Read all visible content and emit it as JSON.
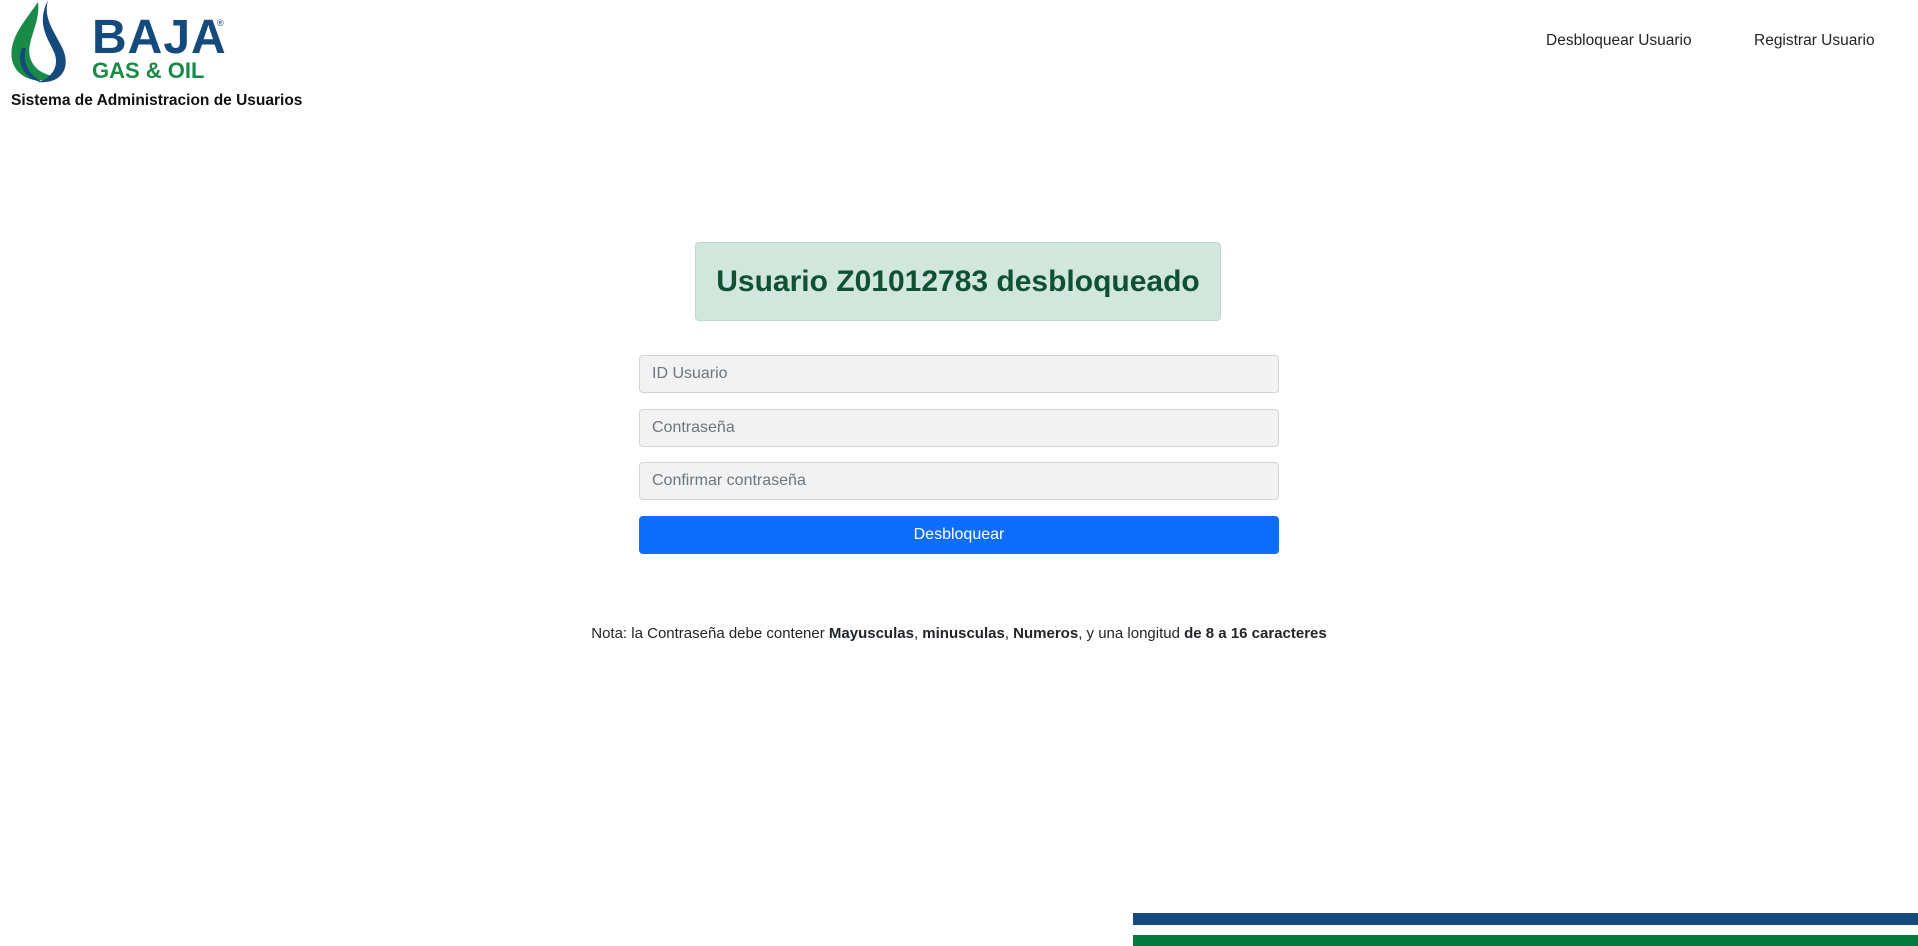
{
  "header": {
    "logo": {
      "brand": "BAJA",
      "registered": "®",
      "tagline": "GAS & OIL"
    },
    "subtitle": "Sistema de Administracion de Usuarios",
    "nav": [
      {
        "label": "Desbloquear Usuario"
      },
      {
        "label": "Registrar Usuario"
      }
    ]
  },
  "alert": {
    "message": "Usuario Z01012783 desbloqueado",
    "type": "success"
  },
  "form": {
    "user_id": {
      "placeholder": "ID Usuario",
      "value": ""
    },
    "password": {
      "placeholder": "Contraseña",
      "value": ""
    },
    "confirm_password": {
      "placeholder": "Confirmar contraseña",
      "value": ""
    },
    "submit_label": "Desbloquear"
  },
  "note": {
    "prefix": "Nota: la Contraseña debe contener ",
    "b1": "Mayusculas",
    "s1": ", ",
    "b2": "minusculas",
    "s2": ", ",
    "b3": "Numeros",
    "s3": ", y una longitud ",
    "b4": "de 8 a 16 caracteres"
  },
  "colors": {
    "brand_blue": "#154a7c",
    "brand_green": "#007a3d",
    "primary": "#0d6efd",
    "success_bg": "#d1e7dd",
    "success_text": "#0f5132"
  }
}
